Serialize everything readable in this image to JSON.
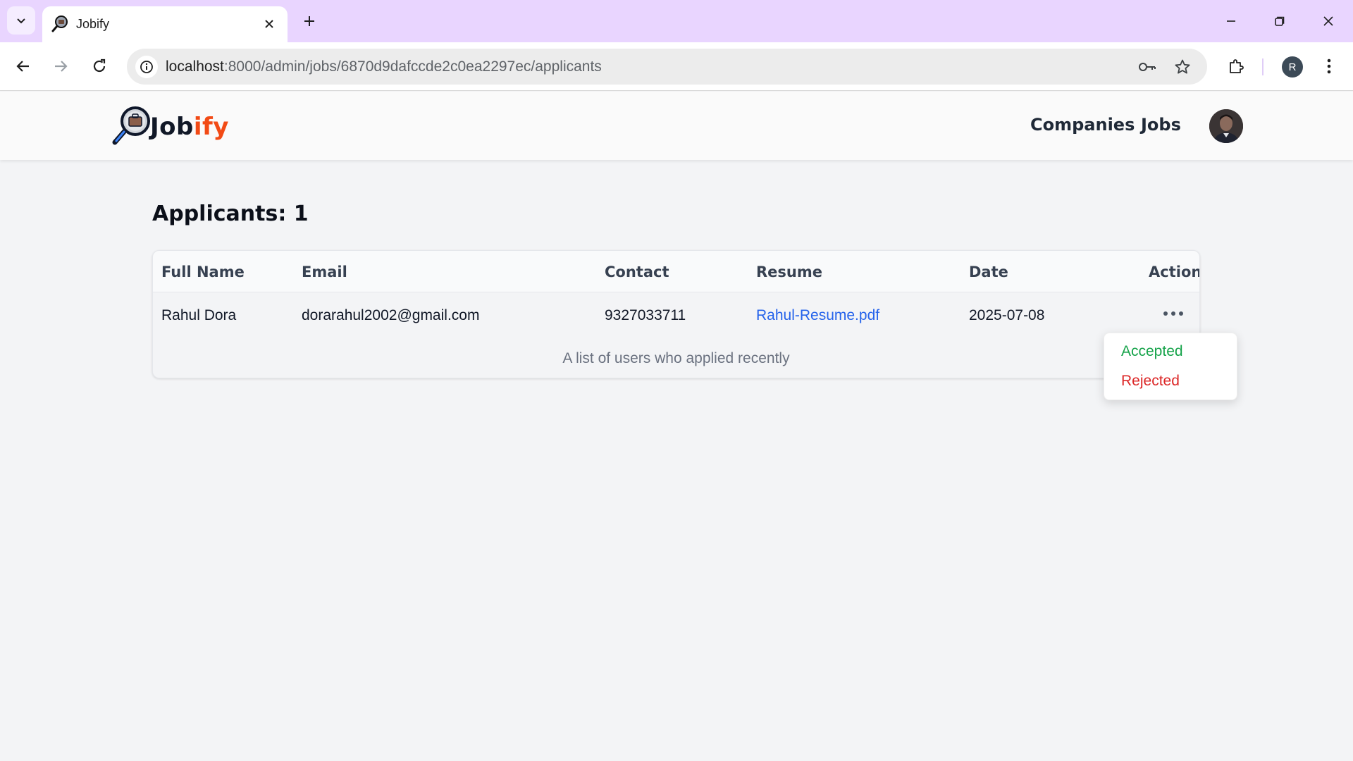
{
  "browser": {
    "tab_title": "Jobify",
    "url_host": "localhost",
    "url_path": ":8000/admin/jobs/6870d9dafccde2c0ea2297ec/applicants",
    "profile_initial": "R",
    "icons": {
      "tab_list": "chevron-down-icon",
      "tab_close": "close-icon",
      "new_tab": "plus-icon",
      "minimize": "minimize-icon",
      "restore": "restore-icon",
      "close": "close-icon",
      "back": "arrow-left-icon",
      "forward": "arrow-right-icon",
      "reload": "reload-icon",
      "site_info": "info-icon",
      "passwords": "key-icon",
      "bookmark": "star-icon",
      "extensions": "puzzle-icon",
      "menu": "kebab-menu-icon"
    }
  },
  "header": {
    "logo_part1": "Job",
    "logo_part2": "ify",
    "nav": [
      "Companies",
      "Jobs"
    ]
  },
  "page": {
    "title": "Applicants: 1"
  },
  "table": {
    "columns": [
      "Full Name",
      "Email",
      "Contact",
      "Resume",
      "Date",
      "Action"
    ],
    "rows": [
      {
        "full_name": "Rahul Dora",
        "email": "dorarahul2002@gmail.com",
        "contact": "9327033711",
        "resume": "Rahul-Resume.pdf",
        "date": "2025-07-08"
      }
    ],
    "caption": "A list of users who applied recently"
  },
  "status_menu": {
    "options": [
      "Accepted",
      "Rejected"
    ]
  },
  "colors": {
    "accent_brand": "#f24a15",
    "link": "#2563eb",
    "accepted": "#16a34a",
    "rejected": "#dc2626",
    "tab_strip": "#e9d5ff"
  }
}
